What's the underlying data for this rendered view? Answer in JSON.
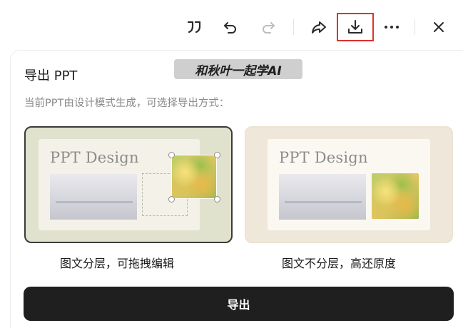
{
  "toolbar": {
    "icons": [
      "quote-icon",
      "undo-icon",
      "redo-icon",
      "share-icon",
      "download-icon",
      "more-icon",
      "close-icon"
    ],
    "download_highlight_color": "#e0312c"
  },
  "dialog": {
    "title": "导出 PPT",
    "watermark": "和秋叶一起学AI",
    "subtitle": "当前PPT由设计模式生成，可选择导出方式：",
    "options": [
      {
        "preview_title": "PPT Design",
        "label": "图文分层，可拖拽编辑",
        "selected": true
      },
      {
        "preview_title": "PPT Design",
        "label": "图文不分层，高还原度",
        "selected": false
      }
    ],
    "export_label": "导出",
    "colors": {
      "primary_button": "#1f1f1f",
      "selected_border": "#3b3b3b",
      "option_a_bg": "#e0e2cd",
      "option_b_bg": "#efe7d9"
    }
  }
}
